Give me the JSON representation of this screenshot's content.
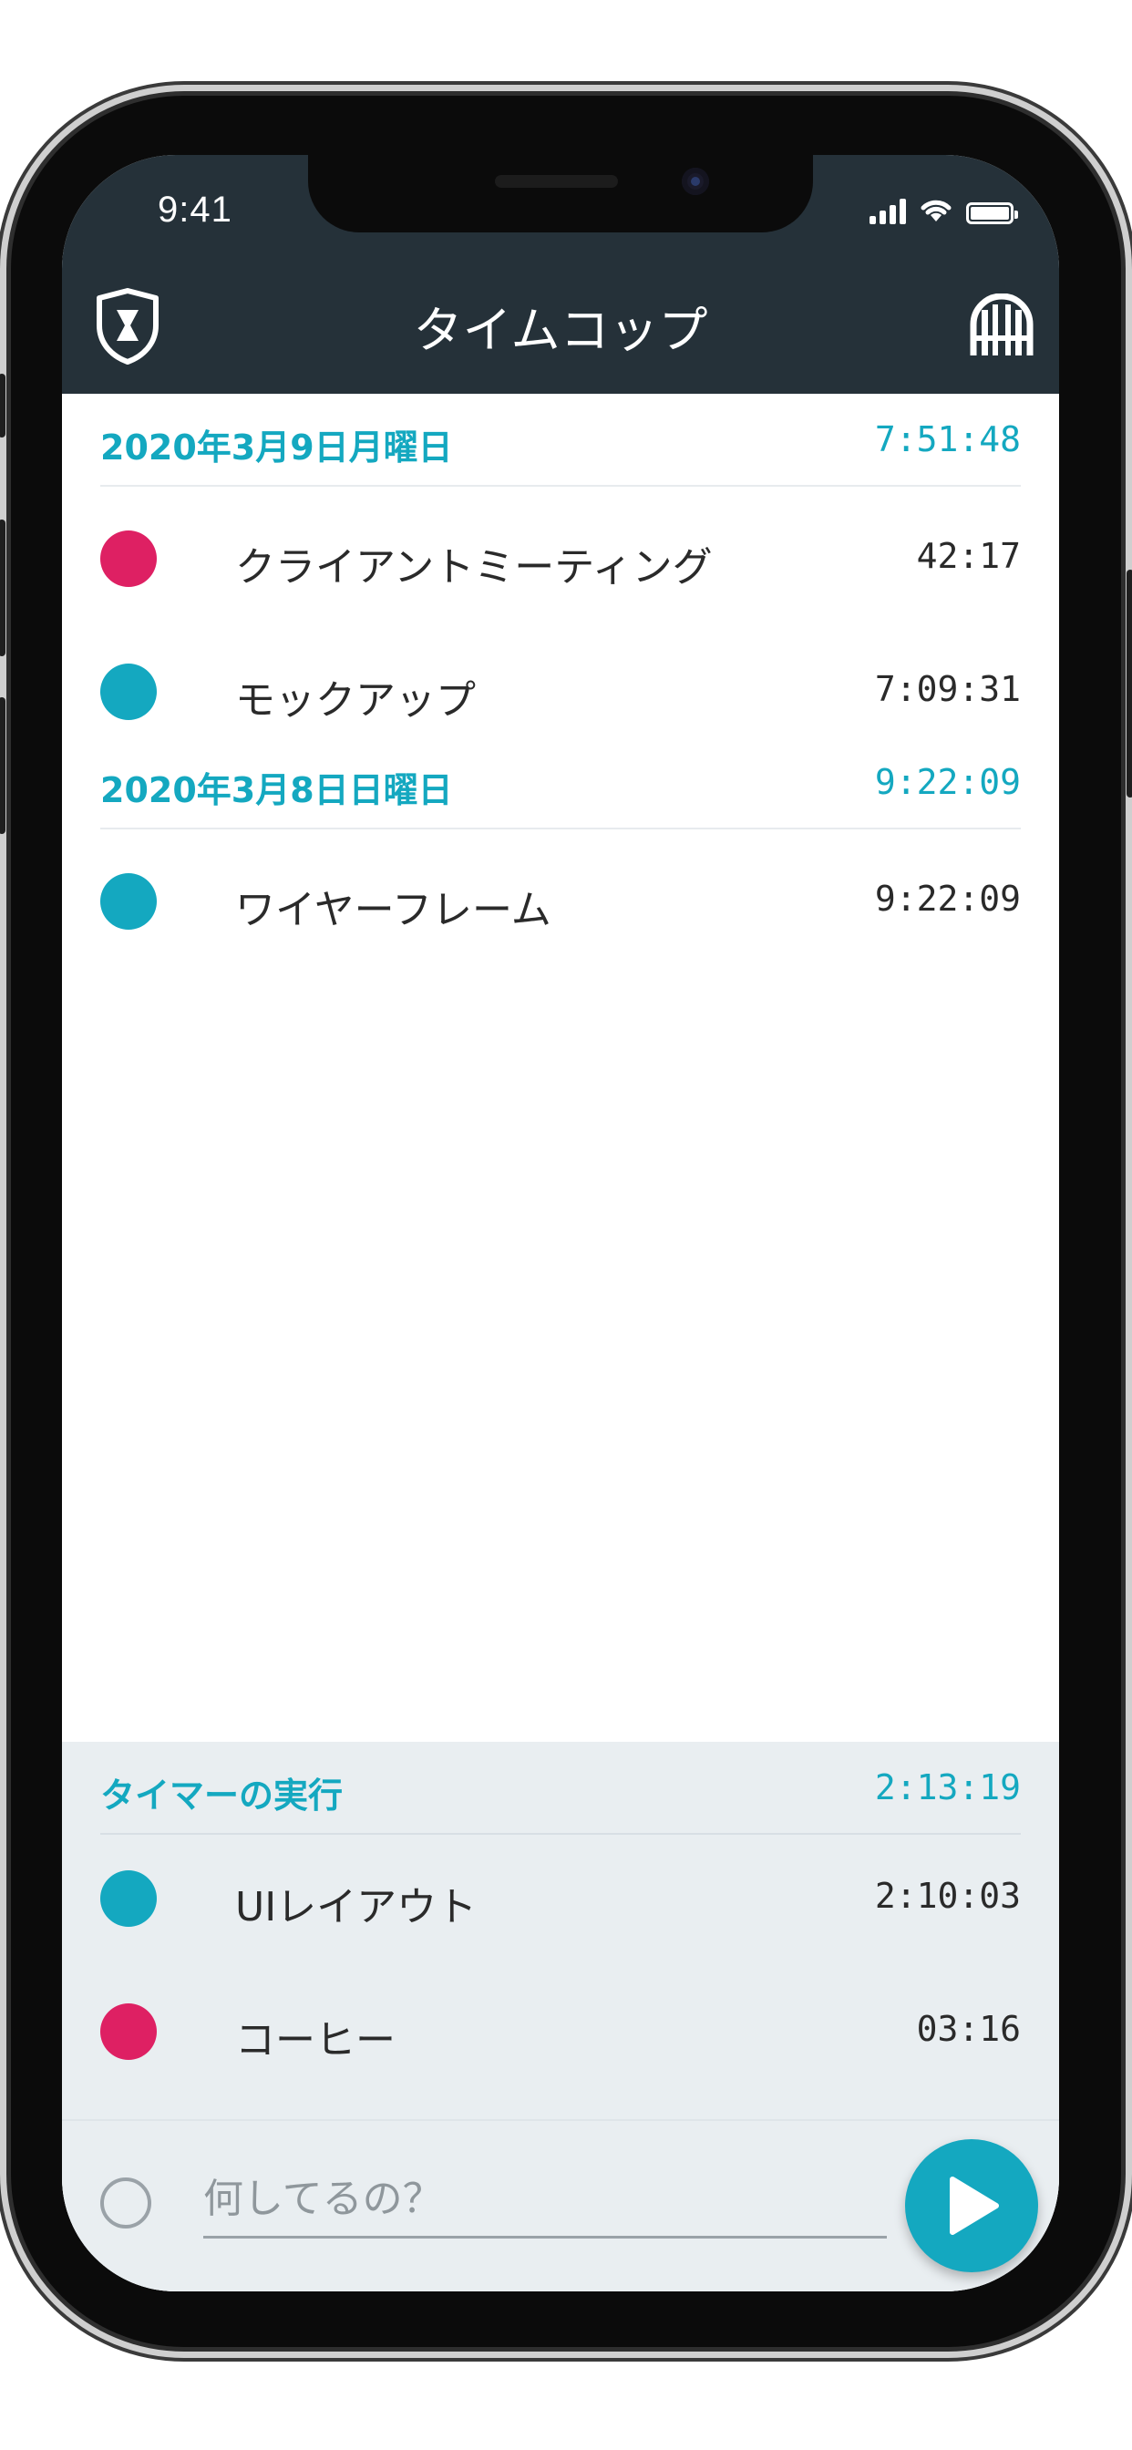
{
  "status_bar": {
    "time": "9:41"
  },
  "app_bar": {
    "title": "タイムコップ",
    "left_icon": "shield-hourglass-icon",
    "right_icon": "gate-icon"
  },
  "colors": {
    "accent": "#14a8c0",
    "header_bg": "#253139",
    "red": "#de2063",
    "teal": "#14a8c0",
    "running_bg": "#e9eef1"
  },
  "days": [
    {
      "date": "2020年3月9日月曜日",
      "total": "7:51:48",
      "entries": [
        {
          "label": "クライアントミーティング",
          "duration": "42:17",
          "color": "#de2063"
        },
        {
          "label": "モックアップ",
          "duration": "7:09:31",
          "color": "#14a8c0"
        }
      ]
    },
    {
      "date": "2020年3月8日日曜日",
      "total": "9:22:09",
      "entries": [
        {
          "label": "ワイヤーフレーム",
          "duration": "9:22:09",
          "color": "#14a8c0"
        }
      ]
    }
  ],
  "running": {
    "title": "タイマーの実行",
    "total": "2:13:19",
    "entries": [
      {
        "label": "UIレイアウト",
        "duration": "2:10:03",
        "color": "#14a8c0"
      },
      {
        "label": "コーヒー",
        "duration": "03:16",
        "color": "#de2063"
      }
    ]
  },
  "composer": {
    "placeholder": "何してるの？",
    "start_icon": "play-icon"
  }
}
